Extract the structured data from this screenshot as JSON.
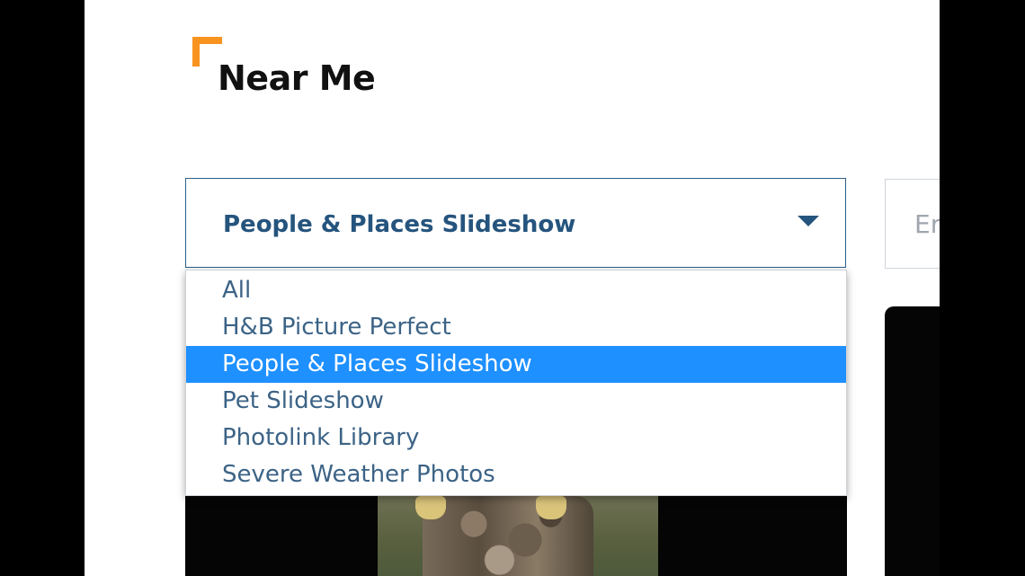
{
  "header": {
    "title": "Near Me"
  },
  "filter": {
    "selected": "People & Places Slideshow",
    "options": [
      "All",
      "H&B Picture Perfect",
      "People & Places Slideshow",
      "Pet Slideshow",
      "Photolink Library",
      "Severe Weather Photos"
    ],
    "selected_index": 2
  },
  "search": {
    "visible_text": "Er"
  },
  "colors": {
    "accent": "#f7931e",
    "select_text": "#25547d",
    "highlight": "#1e90ff",
    "option_text": "#3c6386"
  },
  "icons": {
    "dropdown_caret": "chevron-down-icon",
    "title_mark": "corner-bracket-icon"
  }
}
